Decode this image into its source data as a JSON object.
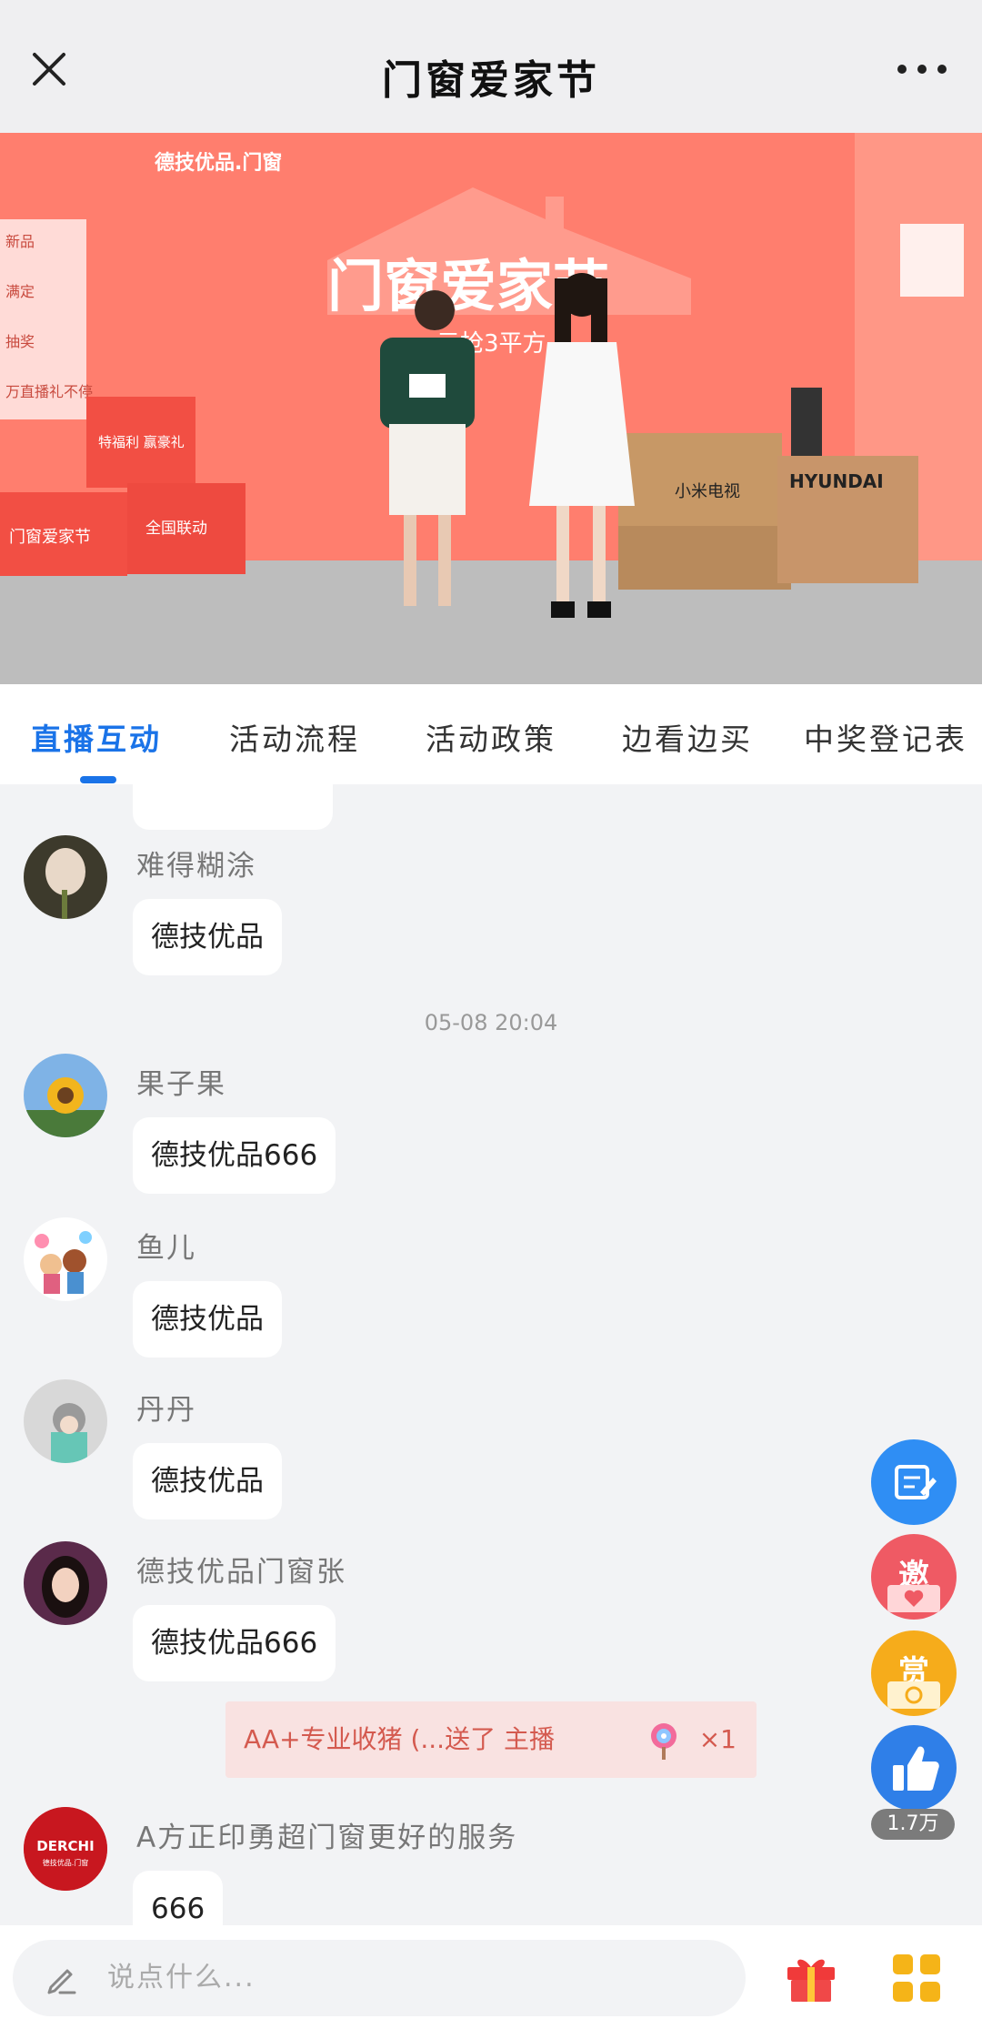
{
  "header": {
    "title": "门窗爱家节"
  },
  "video": {
    "stage_title": "门窗爱家节",
    "stage_subtitle": "元抢3平方",
    "brand_logo": "德技优品.门窗",
    "box_labels": [
      "门窗爱家节",
      "全国联动",
      "特福利 赢豪礼"
    ],
    "tv_box_label": "小米电视",
    "appliance_box_label": "HYUNDAI",
    "left_panel_items": [
      "新品",
      "满定",
      "抽奖",
      "万直播礼不停"
    ]
  },
  "tabs": [
    {
      "label": "直播互动",
      "active": true
    },
    {
      "label": "活动流程",
      "active": false
    },
    {
      "label": "活动政策",
      "active": false
    },
    {
      "label": "边看边买",
      "active": false
    },
    {
      "label": "中奖登记表",
      "active": false
    }
  ],
  "chat": {
    "messages": [
      {
        "name": "难得糊涂",
        "text": "德技优品"
      },
      {
        "name": "果子果",
        "text": "德技优品666"
      },
      {
        "name": "鱼儿",
        "text": "德技优品"
      },
      {
        "name": "丹丹",
        "text": "德技优品"
      },
      {
        "name": "德技优品门窗张",
        "text": "德技优品666"
      },
      {
        "name": "A方正印勇超门窗更好的服务",
        "text": "666"
      }
    ],
    "timestamp": "05-08 20:04",
    "gift_banner": {
      "text": "AA+专业收猪 (...送了 主播",
      "count": "×1"
    },
    "avatar_logo_text": "DERCHI",
    "avatar_logo_sub": "德技优品.门窗"
  },
  "fabs": {
    "invite_label": "邀",
    "reward_label": "赏",
    "like_count": "1.7万"
  },
  "bottom": {
    "input_placeholder": "说点什么..."
  },
  "colors": {
    "accent": "#1a73e8",
    "invite": "#ef5a64",
    "reward": "#f6ac1b",
    "gift_banner_bg": "#f9e2e1"
  }
}
